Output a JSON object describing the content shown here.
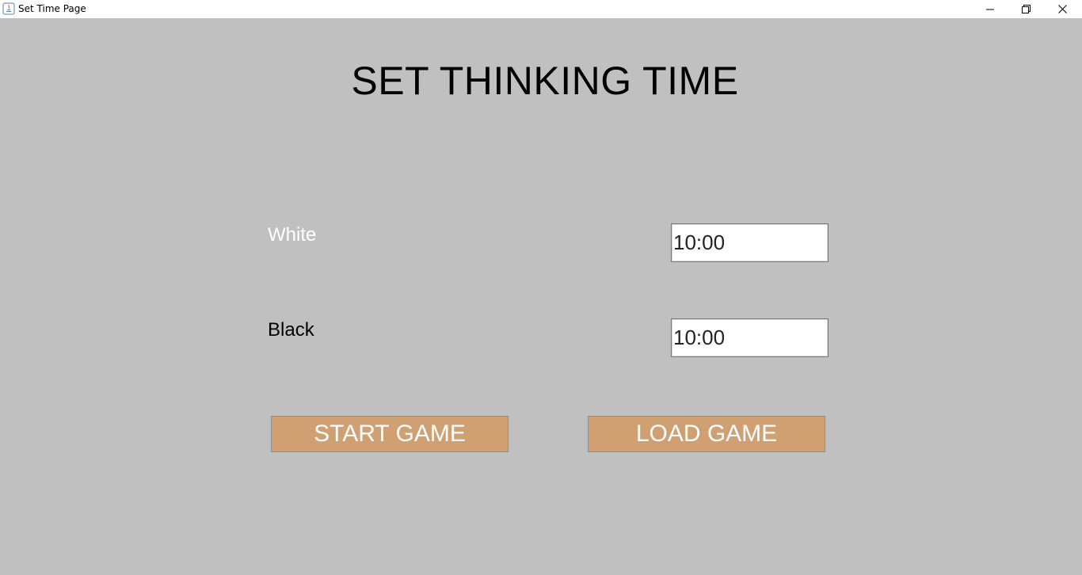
{
  "window": {
    "title": "Set Time Page",
    "app_icon": "java-icon"
  },
  "main": {
    "heading": "SET THINKING TIME",
    "white": {
      "label": "White",
      "time_value": "10:00"
    },
    "black": {
      "label": "Black",
      "time_value": "10:00"
    },
    "buttons": {
      "start_label": "START GAME",
      "load_label": "LOAD GAME"
    }
  },
  "colors": {
    "background": "#c0c0c0",
    "button_fill": "#d0a073",
    "button_text": "#ffffff",
    "white_label": "#ffffff",
    "black_label": "#000000"
  }
}
